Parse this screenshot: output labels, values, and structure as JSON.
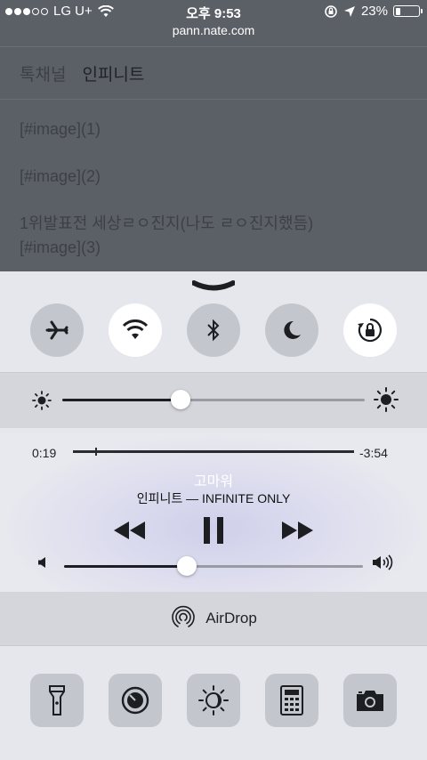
{
  "status": {
    "carrier": "LG U+",
    "time": "오후 9:53",
    "battery": "23%",
    "battery_level": 0.23
  },
  "browser": {
    "url": "pann.nate.com"
  },
  "page": {
    "nav": [
      "톡채널",
      "인피니트"
    ],
    "lines": [
      "[#image](1)",
      "[#image](2)",
      "1위발표전 세상ㄹㅇ진지(나도 ㄹㅇ진지했듬)",
      "[#image](3)"
    ]
  },
  "control_center": {
    "toggles": [
      {
        "name": "airplane",
        "on": false
      },
      {
        "name": "wifi",
        "on": true
      },
      {
        "name": "bluetooth",
        "on": false
      },
      {
        "name": "do-not-disturb",
        "on": false
      },
      {
        "name": "rotation-lock",
        "on": true
      }
    ],
    "brightness_level": 0.39,
    "music": {
      "elapsed": "0:19",
      "remaining": "-3:54",
      "progress": 0.08,
      "title": "고마워",
      "artist_album": "인피니트 — INFINITE ONLY",
      "volume_level": 0.41
    },
    "airdrop_label": "AirDrop",
    "tools": [
      "flashlight",
      "timer",
      "night-shift",
      "calculator",
      "camera"
    ]
  },
  "colors": {
    "panel": "#e6e7ec",
    "toggle_off": "#c4c6ce",
    "toggle_on": "#ffffff",
    "dim_overlay": "#5b5f66"
  }
}
